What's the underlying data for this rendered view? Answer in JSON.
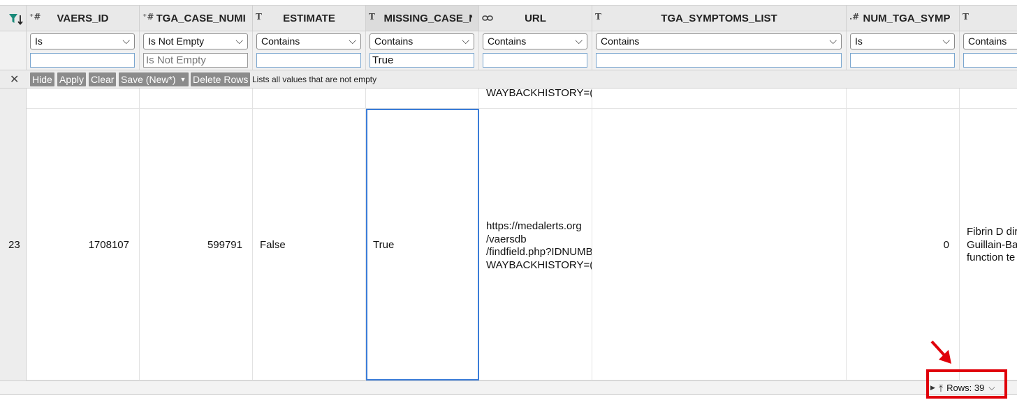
{
  "columns": [
    {
      "name": "VAERS_ID",
      "type_icon": "*#",
      "operator": "Is",
      "value": ""
    },
    {
      "name": "TGA_CASE_NUMI",
      "type_icon": "*#",
      "operator": "Is Not Empty",
      "value": "Is Not Empty"
    },
    {
      "name": "ESTIMATE",
      "type_icon": "T",
      "operator": "Contains",
      "value": ""
    },
    {
      "name": "MISSING_CASE_N",
      "type_icon": "T",
      "operator": "Contains",
      "value": "True"
    },
    {
      "name": "URL",
      "type_icon": "link",
      "operator": "Contains",
      "value": ""
    },
    {
      "name": "TGA_SYMPTOMS_LIST",
      "type_icon": "T",
      "operator": "Contains",
      "value": ""
    },
    {
      "name": "NUM_TGA_SYMP",
      "type_icon": ".#",
      "operator": "Is",
      "value": ""
    },
    {
      "name": "",
      "type_icon": "T",
      "operator": "Contains",
      "value": ""
    }
  ],
  "toolbar": {
    "hide": "Hide",
    "apply": "Apply",
    "clear": "Clear",
    "save": "Save (New*)",
    "delete_rows": "Delete Rows",
    "description": "Lists all values that are not empty"
  },
  "prev_row": {
    "url_tail": "WAYBACKHISTORY=("
  },
  "row": {
    "index": "23",
    "vaers_id": "1708107",
    "tga_case_number": "599791",
    "estimate": "False",
    "missing_case": "True",
    "url": "https://medalerts.org\n/vaersdb\n/findfield.php?IDNUMBE\nWAYBACKHISTORY=(",
    "num_tga_symp": "0",
    "last_col": "Fibrin D dir\nGuillain-Ba\nfunction te"
  },
  "footer": {
    "rows_label": "Rows: 39"
  },
  "colors": {
    "highlight": "#e0000a",
    "selected_cell_border": "#3b7dd8",
    "filter_icon": "#1a8a7a"
  }
}
